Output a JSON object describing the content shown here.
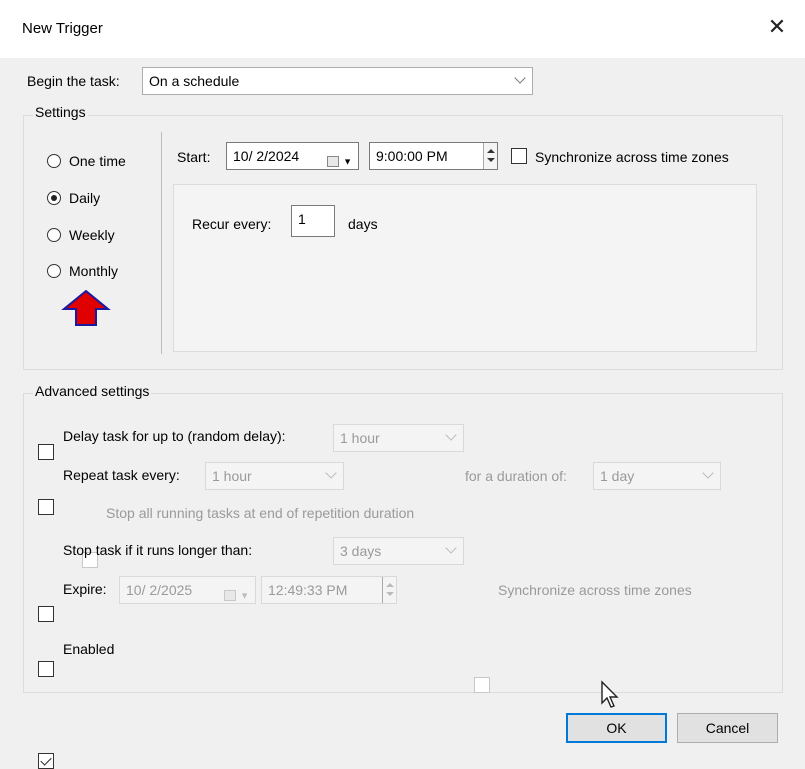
{
  "window": {
    "title": "New Trigger",
    "close_glyph": "✕"
  },
  "begin_task": {
    "label": "Begin the task:",
    "value": "On a schedule"
  },
  "settings": {
    "legend": "Settings",
    "schedule_options": [
      {
        "label": "One time",
        "checked": false
      },
      {
        "label": "Daily",
        "checked": true
      },
      {
        "label": "Weekly",
        "checked": false
      },
      {
        "label": "Monthly",
        "checked": false
      }
    ],
    "start_label": "Start:",
    "start_date": "10/ 2/2024",
    "start_time": "9:00:00 PM",
    "sync_label": "Synchronize across time zones",
    "recur_label": "Recur every:",
    "recur_value": "1",
    "recur_unit": "days"
  },
  "advanced": {
    "legend": "Advanced settings",
    "delay_label": "Delay task for up to (random delay):",
    "delay_value": "1 hour",
    "repeat_label": "Repeat task every:",
    "repeat_value": "1 hour",
    "duration_label": "for a duration of:",
    "duration_value": "1 day",
    "stop_running_label": "Stop all running tasks at end of repetition duration",
    "stop_longer_label": "Stop task if it runs longer than:",
    "stop_longer_value": "3 days",
    "expire_label": "Expire:",
    "expire_date": "10/ 2/2025",
    "expire_time": "12:49:33 PM",
    "expire_sync_label": "Synchronize across time zones",
    "enabled_label": "Enabled",
    "enabled_checked": true
  },
  "buttons": {
    "ok": "OK",
    "cancel": "Cancel"
  },
  "annotation": {
    "arrow_color": "#e00000",
    "arrow_outline": "#1a1aa0"
  }
}
